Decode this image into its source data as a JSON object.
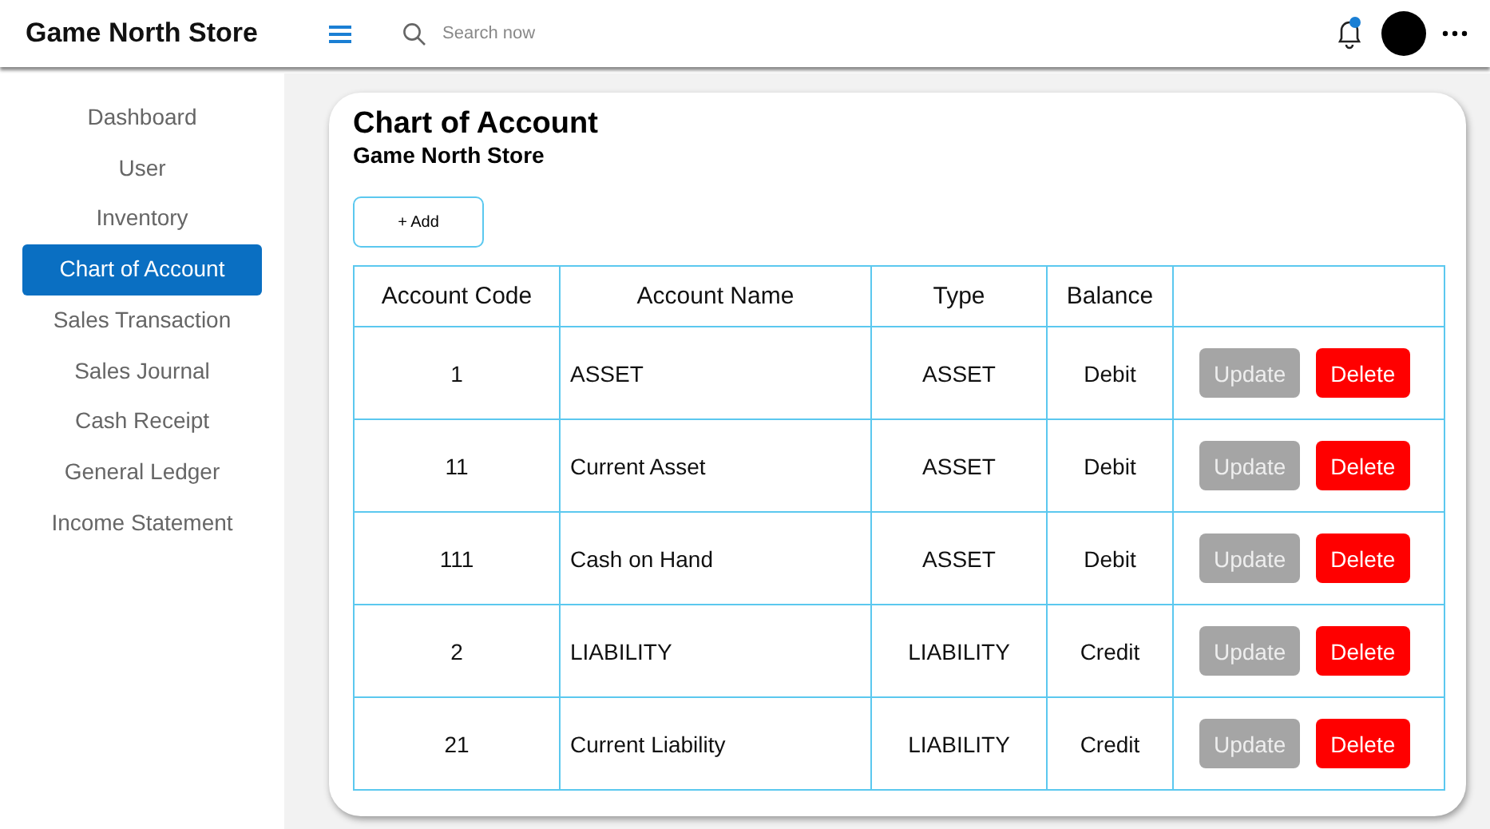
{
  "header": {
    "title": "Game North Store",
    "search": {
      "placeholder": "Search now"
    }
  },
  "sidebar": {
    "items": [
      {
        "label": "Dashboard",
        "selected": false
      },
      {
        "label": "User",
        "selected": false
      },
      {
        "label": "Inventory",
        "selected": false
      },
      {
        "label": "Chart of Account",
        "selected": true
      },
      {
        "label": "Sales Transaction",
        "selected": false
      },
      {
        "label": "Sales Journal",
        "selected": false
      },
      {
        "label": "Cash Receipt",
        "selected": false
      },
      {
        "label": "General Ledger",
        "selected": false
      },
      {
        "label": "Income Statement",
        "selected": false
      }
    ]
  },
  "page": {
    "title": "Chart of Account",
    "subtitle": "Game North Store",
    "add_button": "+ Add"
  },
  "table": {
    "columns": [
      "Account Code",
      "Account Name",
      "Type",
      "Balance"
    ],
    "rows": [
      {
        "code": "1",
        "name": "ASSET",
        "type": "ASSET",
        "balance": "Debit",
        "actions": [
          {
            "kind": "update",
            "label": "Update",
            "disabled": true
          },
          {
            "kind": "delete",
            "label": "Delete",
            "disabled": false
          }
        ]
      },
      {
        "code": "11",
        "name": "Current Asset",
        "type": "ASSET",
        "balance": "Debit",
        "actions": [
          {
            "kind": "update",
            "label": "Update",
            "disabled": true
          },
          {
            "kind": "delete",
            "label": "Delete",
            "disabled": false
          }
        ]
      },
      {
        "code": "111",
        "name": "Cash on Hand",
        "type": "ASSET",
        "balance": "Debit",
        "actions": [
          {
            "kind": "update",
            "label": "Update",
            "disabled": true
          },
          {
            "kind": "delete",
            "label": "Delete",
            "disabled": false
          }
        ]
      },
      {
        "code": "2",
        "name": "LIABILITY",
        "type": "LIABILITY",
        "balance": "Credit",
        "actions": [
          {
            "kind": "update",
            "label": "Update",
            "disabled": true
          },
          {
            "kind": "delete",
            "label": "Delete",
            "disabled": false
          }
        ]
      },
      {
        "code": "21",
        "name": "Current Liability",
        "type": "LIABILITY",
        "balance": "Credit",
        "actions": [
          {
            "kind": "update",
            "label": "Update",
            "disabled": true
          },
          {
            "kind": "delete",
            "label": "Delete",
            "disabled": false
          }
        ]
      }
    ]
  }
}
